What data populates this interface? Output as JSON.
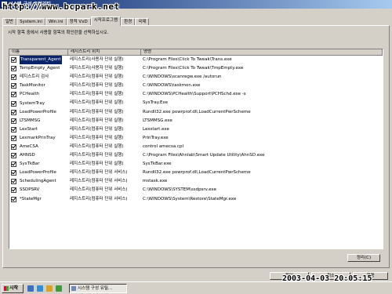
{
  "window": {
    "title": "시스템 구성 유틸리티"
  },
  "watermark": "http://www.bcpark.net",
  "tabs": [
    "일반",
    "System.ini",
    "Win.ini",
    "정적 VxD",
    "시작프로그램",
    "환경",
    "국제"
  ],
  "active_tab": 4,
  "instruction": "시작 항목 중에서 사용할 항목의 확인란을 선택하십시오.",
  "columns": {
    "name": "이름",
    "location": "레지스트리 위치",
    "command": "명령"
  },
  "rows": [
    {
      "name": "Transparent_Agent",
      "location": "레지스트리(사용자 단위 실행)",
      "command": "C:\\Program Files\\Click To Tweak\\Trans.exe",
      "checked": true,
      "selected": true
    },
    {
      "name": "TempEmpty_Agent",
      "location": "레지스트리(사용자 단위 실행)",
      "command": "C:\\Program Files\\Click To Tweak\\TmpEmpty.exe",
      "checked": true
    },
    {
      "name": "레지스트리 검사",
      "location": "레지스트리(컴퓨터 단위 실행)",
      "command": "C:\\WINDOWS\\scanregw.exe /autorun",
      "checked": true
    },
    {
      "name": "TaskMonitor",
      "location": "레지스트리(컴퓨터 단위 실행)",
      "command": "C:\\WINDOWS\\taskmon.exe",
      "checked": true
    },
    {
      "name": "PCHealth",
      "location": "레지스트리(컴퓨터 단위 실행)",
      "command": "C:\\WINDOWS\\PCHealth\\Support\\PCHSchd.exe -s",
      "checked": true
    },
    {
      "name": "SystemTray",
      "location": "레지스트리(컴퓨터 단위 실행)",
      "command": "SysTray.Exe",
      "checked": true
    },
    {
      "name": "LoadPowerProfile",
      "location": "레지스트리(컴퓨터 단위 실행)",
      "command": "Rundll32.exe powrprof.dll,LoadCurrentPwrScheme",
      "checked": true
    },
    {
      "name": "LTSMMSG",
      "location": "레지스트리(컴퓨터 단위 실행)",
      "command": "LTSMMSG.exe",
      "checked": true
    },
    {
      "name": "LexStart",
      "location": "레지스트리(컴퓨터 단위 실행)",
      "command": "Lexstart.exe",
      "checked": true
    },
    {
      "name": "LexmarkPrinTray",
      "location": "레지스트리(컴퓨터 단위 실행)",
      "command": "PrinTray.exe",
      "checked": true
    },
    {
      "name": "AmeCSA",
      "location": "레지스트리(컴퓨터 단위 실행)",
      "command": "control amecsa.cpl",
      "checked": true
    },
    {
      "name": "AHNSD",
      "location": "레지스트리(컴퓨터 단위 실행)",
      "command": "C:\\Program Files\\Ahnlab\\Smart Update Utility\\AhnSD.exe",
      "checked": true
    },
    {
      "name": "SysTkBar",
      "location": "레지스트리(컴퓨터 단위 실행)",
      "command": "SysTkBar.exe",
      "checked": true
    },
    {
      "name": "LoadPowerProfile",
      "location": "레지스트리(컴퓨터 단위 서비스)",
      "command": "Rundll32.exe powrprof.dll,LoadCurrentPwrScheme",
      "checked": true
    },
    {
      "name": "SchedulingAgent",
      "location": "레지스트리(컴퓨터 단위 서비스)",
      "command": "mstask.exe",
      "checked": true
    },
    {
      "name": "SSDPSRV",
      "location": "레지스트리(컴퓨터 단위 서비스)",
      "command": "C:\\WINDOWS\\SYSTEM\\ssdpsrv.exe",
      "checked": true
    },
    {
      "name": "*StateMgr",
      "location": "레지스트리(컴퓨터 단위 서비스)",
      "command": "C:\\WINDOWS\\System\\Restore\\StateMgr.exe",
      "checked": true
    }
  ],
  "buttons": {
    "cleanup": "정리(C)",
    "ok": "확인",
    "cancel": "취소",
    "apply": "적용"
  },
  "taskbar": {
    "start": "시작",
    "task": "시스템 구성 유틸..."
  },
  "timestamp": "2003-04-03 20:05:15"
}
